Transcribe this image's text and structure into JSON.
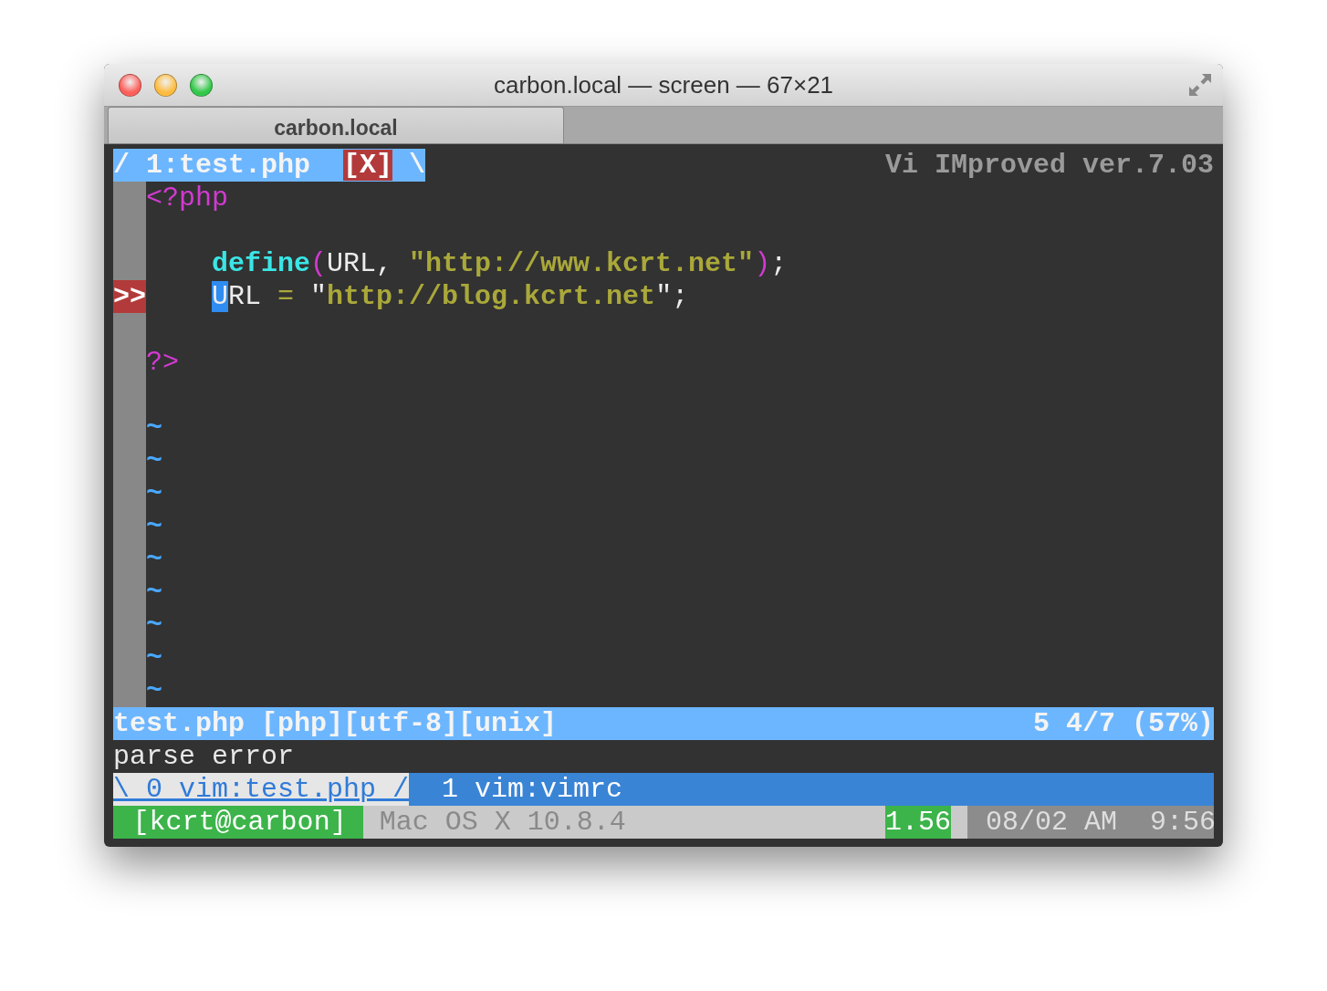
{
  "window": {
    "title": "carbon.local — screen — 67×21"
  },
  "tabs": [
    {
      "label": "carbon.local",
      "selected": true
    }
  ],
  "vim": {
    "tabline": {
      "tabs": [
        {
          "lead": "/",
          "label": "1:test.php",
          "modified": "[X]",
          "trail": "\\",
          "selected": true
        }
      ],
      "title": "Vi IMproved ver.7.03"
    },
    "lines": [
      {
        "kind": "code",
        "indented": false,
        "segments": [
          {
            "kind": "tag",
            "text": "<?php"
          }
        ]
      },
      {
        "kind": "blank"
      },
      {
        "kind": "code",
        "indented": true,
        "segments": [
          {
            "kind": "func",
            "text": "define"
          },
          {
            "kind": "paren",
            "text": "("
          },
          {
            "kind": "plain",
            "text": "URL, "
          },
          {
            "kind": "string",
            "text": "\"http://www.kcrt.net\""
          },
          {
            "kind": "paren",
            "text": ")"
          },
          {
            "kind": "plain",
            "text": ";"
          }
        ]
      },
      {
        "kind": "code",
        "sign": ">>",
        "indented": true,
        "segments": [
          {
            "kind": "cursor",
            "text": "U"
          },
          {
            "kind": "plain",
            "text": "RL "
          },
          {
            "kind": "op",
            "text": "="
          },
          {
            "kind": "plain",
            "text": " \""
          },
          {
            "kind": "string",
            "text": "http://blog.kcrt.net"
          },
          {
            "kind": "plain",
            "text": "\";"
          }
        ]
      },
      {
        "kind": "blank"
      },
      {
        "kind": "code",
        "indented": false,
        "segments": [
          {
            "kind": "tag",
            "text": "?>"
          }
        ]
      },
      {
        "kind": "blank"
      },
      {
        "kind": "tilde",
        "text": "~"
      },
      {
        "kind": "tilde",
        "text": "~"
      },
      {
        "kind": "tilde",
        "text": "~"
      },
      {
        "kind": "tilde",
        "text": "~"
      },
      {
        "kind": "tilde",
        "text": "~"
      },
      {
        "kind": "tilde",
        "text": "~"
      },
      {
        "kind": "tilde",
        "text": "~"
      },
      {
        "kind": "tilde",
        "text": "~"
      },
      {
        "kind": "tilde",
        "text": "~"
      }
    ],
    "status_line": {
      "left": "test.php [php][utf-8][unix]",
      "right": "5 4/7 (57%)"
    },
    "message": "parse error"
  },
  "screen": {
    "windows": [
      {
        "label": "\\ 0 vim:test.php /",
        "selected": true
      },
      {
        "label": "1 vim:vimrc",
        "selected": false
      }
    ],
    "hardstatus": [
      {
        "kind": "host",
        "text": "[kcrt@carbon]"
      },
      {
        "kind": "os",
        "text": "Mac OS X 10.8.4"
      },
      {
        "kind": "load",
        "text": "1.56"
      },
      {
        "kind": "clock",
        "text": "08/02 AM  9:56"
      }
    ]
  }
}
